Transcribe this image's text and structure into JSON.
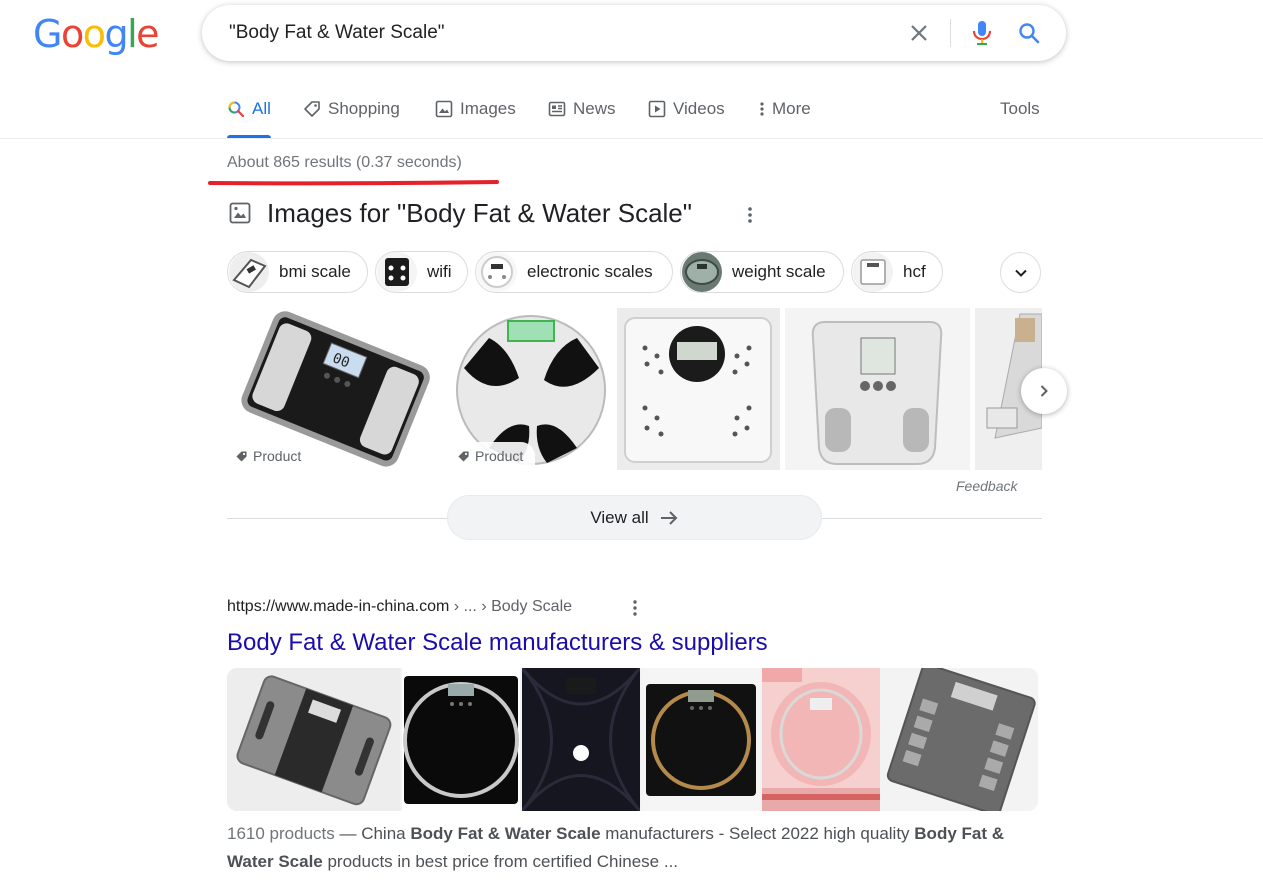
{
  "logo": {
    "letters": [
      "G",
      "o",
      "o",
      "g",
      "l",
      "e"
    ],
    "colors": [
      "#4285F4",
      "#EA4335",
      "#FBBC05",
      "#4285F4",
      "#34A853",
      "#EA4335"
    ]
  },
  "search": {
    "query": "\"Body Fat & Water Scale\""
  },
  "tabs": [
    {
      "label": "All",
      "icon": "search-icon",
      "active": true
    },
    {
      "label": "Shopping",
      "icon": "tag-icon"
    },
    {
      "label": "Images",
      "icon": "image-icon"
    },
    {
      "label": "News",
      "icon": "newspaper-icon"
    },
    {
      "label": "Videos",
      "icon": "play-icon"
    },
    {
      "label": "More",
      "icon": "more-vert-icon"
    }
  ],
  "tools_label": "Tools",
  "result_stats": "About 865 results (0.37 seconds)",
  "images_section": {
    "title": "Images for \"Body Fat & Water Scale\"",
    "chips": [
      "bmi scale",
      "wifi",
      "electronic scales",
      "weight scale",
      "hcf"
    ],
    "product_tag": "Product",
    "feedback": "Feedback",
    "view_all": "View all"
  },
  "result": {
    "domain": "https://www.made-in-china.com",
    "breadcrumb": " › ... › Body Scale",
    "title": "Body Fat & Water Scale manufacturers & suppliers",
    "snippet": {
      "count": "1610 products",
      "dash": " — China ",
      "b1": "Body Fat & Water Scale",
      "t2": " manufacturers - Select 2022 high quality ",
      "b2": "Body Fat & Water Scale",
      "t3": " products in best price from certified Chinese ..."
    }
  },
  "accent_color": "#1a73e8",
  "link_color": "#1a0dab"
}
